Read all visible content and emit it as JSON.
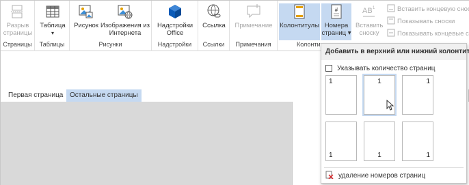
{
  "ribbon": {
    "groups": [
      {
        "label": "Страницы"
      },
      {
        "label": "Таблицы"
      },
      {
        "label": "Рисунки"
      },
      {
        "label": "Надстройки"
      },
      {
        "label": "Ссылки"
      },
      {
        "label": "Примечания"
      },
      {
        "label": "Колонтитулы"
      }
    ],
    "buttons": {
      "page_break": {
        "line1": "Разрыв",
        "line2": "страницы"
      },
      "table": {
        "line1": "Таблица",
        "line2": "▾"
      },
      "picture": {
        "line1": "Рисунок"
      },
      "online_pictures": {
        "line1": "Изображения из",
        "line2": "Интернета"
      },
      "addins": {
        "line1": "Надстройки",
        "line2": "Office"
      },
      "link": {
        "line1": "Ссылка"
      },
      "comment": {
        "line1": "Примечание"
      },
      "header_footer": {
        "line1": "Колонтитулы"
      },
      "page_numbers": {
        "line1": "Номера",
        "line2": "страниц ▾"
      },
      "insert_footnote": {
        "line1": "Вставить",
        "line2": "сноску"
      }
    },
    "small_buttons": [
      "Вставить концевую сноск",
      "Показывать сноски",
      "Показывать концевые сн"
    ]
  },
  "tabs": [
    {
      "label": "Первая страница",
      "active": false
    },
    {
      "label": "Остальные страницы",
      "active": true
    }
  ],
  "dropdown": {
    "title": "Добавить в верхний или нижний колонтитул",
    "checkbox_label": "Указывать количество страниц",
    "thumbnails": [
      {
        "number": "1",
        "position": "top-left"
      },
      {
        "number": "1",
        "position": "top-center"
      },
      {
        "number": "1",
        "position": "top-right"
      },
      {
        "number": "1",
        "position": "bottom-left"
      },
      {
        "number": "1",
        "position": "bottom-center"
      },
      {
        "number": "1",
        "position": "bottom-right"
      }
    ],
    "remove_label": "удаление номеров страниц"
  },
  "colors": {
    "accent_selected": "#c5d9f1",
    "office_blue": "#0a5bb8",
    "remove_red": "#d9252a"
  }
}
